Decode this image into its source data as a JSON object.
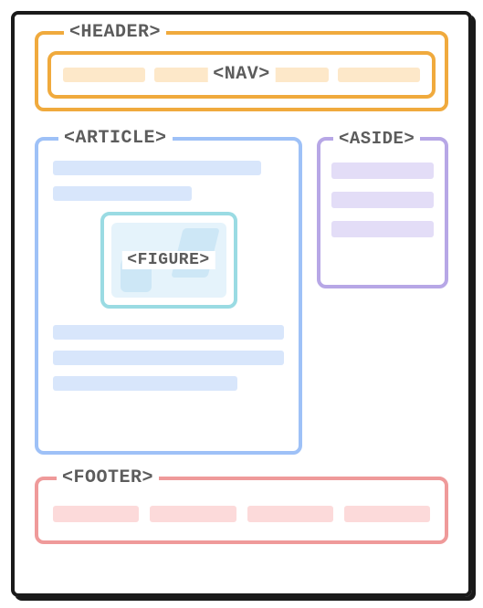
{
  "header": {
    "label": "<HEADER>"
  },
  "nav": {
    "label": "<NAV>",
    "item_count": 4
  },
  "article": {
    "label": "<ARTICLE>",
    "lines_above_figure": [
      90,
      60
    ],
    "lines_below_figure": [
      100,
      100,
      80
    ]
  },
  "figure": {
    "label": "<FIGURE>"
  },
  "aside": {
    "label": "<ASIDE>",
    "line_count": 3
  },
  "footer": {
    "label": "<FOOTER>",
    "item_count": 4
  },
  "colors": {
    "header": "#f0aa3d",
    "nav": "#f0aa3d",
    "article": "#9ec1f7",
    "figure": "#9adbe3",
    "aside": "#b7a7e6",
    "footer": "#ef9a9a"
  }
}
